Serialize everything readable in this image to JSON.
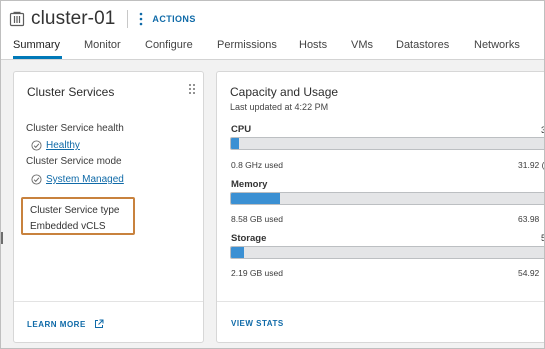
{
  "header": {
    "title": "cluster-01",
    "actions_label": "ACTIONS"
  },
  "tabs": [
    {
      "label": "Summary",
      "active": true
    },
    {
      "label": "Monitor"
    },
    {
      "label": "Configure"
    },
    {
      "label": "Permissions"
    },
    {
      "label": "Hosts"
    },
    {
      "label": "VMs"
    },
    {
      "label": "Datastores"
    },
    {
      "label": "Networks"
    }
  ],
  "cluster_services": {
    "title": "Cluster Services",
    "health_label": "Cluster Service health",
    "health_value": "Healthy",
    "mode_label": "Cluster Service mode",
    "mode_value": "System Managed",
    "type_label": "Cluster Service type",
    "type_value": "Embedded vCLS",
    "footer_link": "LEARN MORE"
  },
  "capacity": {
    "title": "Capacity and Usage",
    "last_updated": "Last updated at 4:22 PM",
    "resources": [
      {
        "name": "CPU",
        "capacity_partial": "3",
        "used": "0.8 GHz used",
        "total_partial": "31.92 (",
        "fill_percent": 2.5
      },
      {
        "name": "Memory",
        "capacity_partial": "",
        "used": "8.58 GB used",
        "total_partial": "63.98",
        "fill_percent": 15
      },
      {
        "name": "Storage",
        "capacity_partial": "5",
        "used": "2.19 GB used",
        "total_partial": "54.92",
        "fill_percent": 4
      }
    ],
    "footer_link": "VIEW STATS"
  },
  "colors": {
    "accent": "#0079b8",
    "link": "#0f6aa8",
    "bar_fill": "#3b90d3",
    "highlight": "#c8823e"
  },
  "icons": [
    "cluster-icon",
    "kebab-icon",
    "drag-handle-icon",
    "check-circle-icon",
    "external-link-icon"
  ]
}
